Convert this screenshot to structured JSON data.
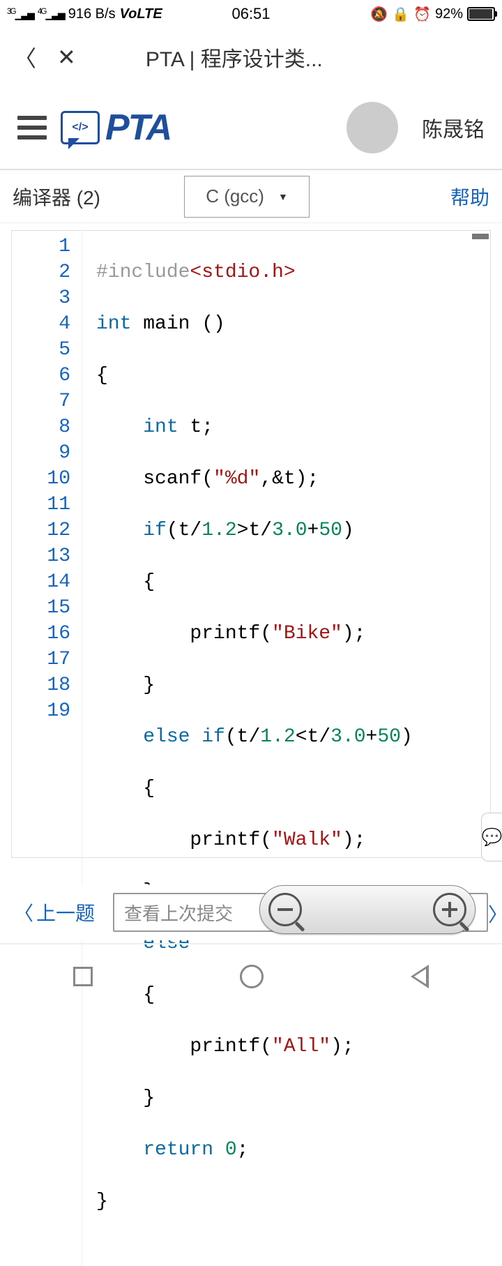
{
  "status": {
    "signal_left_label": "3G",
    "signal_right_label": "4G",
    "network_speed": "916 B/s",
    "volte": "VoLTE",
    "time": "06:51",
    "battery_pct": "92%"
  },
  "browser": {
    "page_title": "PTA | 程序设计类..."
  },
  "header": {
    "logo_badge_text": "</>",
    "logo_text": "PTA",
    "username": "陈晟铭"
  },
  "toolbar": {
    "compiler_label": "编译器 (2)",
    "language_selected": "C (gcc)",
    "help_label": "帮助"
  },
  "editor": {
    "lines": [
      "1",
      "2",
      "3",
      "4",
      "5",
      "6",
      "7",
      "8",
      "9",
      "10",
      "11",
      "12",
      "13",
      "14",
      "15",
      "16",
      "17",
      "18",
      "19"
    ]
  },
  "code": {
    "l1a": "#include",
    "l1b": "<stdio.h>",
    "l2a": "int",
    "l2b": " main ()",
    "l3": "{",
    "l4a": "int",
    "l4b": " t;",
    "l5a": "scanf(",
    "l5b": "\"%d\"",
    "l5c": ",&t);",
    "l6a": "if",
    "l6b": "(t/",
    "l6c": "1.2",
    "l6d": ">t/",
    "l6e": "3.0",
    "l6f": "+",
    "l6g": "50",
    "l6h": ")",
    "l7": "{",
    "l8a": "printf(",
    "l8b": "\"Bike\"",
    "l8c": ");",
    "l9": "}",
    "l10a": "else",
    "l10b": " ",
    "l10c": "if",
    "l10d": "(t/",
    "l10e": "1.2",
    "l10f": "<t/",
    "l10g": "3.0",
    "l10h": "+",
    "l10i": "50",
    "l10j": ")",
    "l11": "{",
    "l12a": "printf(",
    "l12b": "\"Walk\"",
    "l12c": ");",
    "l13": "}",
    "l14": "else",
    "l15": "{",
    "l16a": "printf(",
    "l16b": "\"All\"",
    "l16c": ");",
    "l17": "}",
    "l18a": "return",
    "l18b": " ",
    "l18c": "0",
    "l18d": ";",
    "l19": "}"
  },
  "bottom": {
    "prev_label": "上一题",
    "view_last_placeholder": "查看上次提交"
  }
}
